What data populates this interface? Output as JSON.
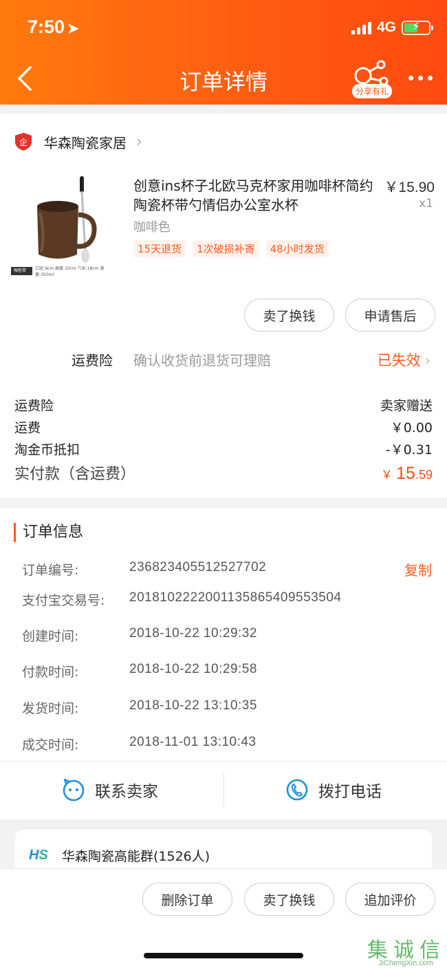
{
  "status_bar": {
    "time": "7:50",
    "network": "4G"
  },
  "nav": {
    "title": "订单详情",
    "share_badge": "分享有礼"
  },
  "shop": {
    "name": "华森陶瓷家居"
  },
  "product": {
    "title": "创意ins杯子北欧马克杯家用咖啡杯简约陶瓷杯带勺情侣办公室水杯",
    "price": "￥15.90",
    "qty": "x1",
    "sku": "咖啡色",
    "tags": [
      "15天退货",
      "1次破损补寄",
      "48小时发货"
    ],
    "image_tag": "咖色带勺",
    "image_caption": "口径:9cm 高度:10cm 勺长:18cm 容量:350ml"
  },
  "actions_top": {
    "sell_for_cash": "卖了换钱",
    "after_sales": "申请售后"
  },
  "insurance": {
    "label": "运费险",
    "desc": "确认收货前退货可理赔",
    "status": "已失效"
  },
  "fees": {
    "insurance_label": "运费险",
    "insurance_value": "卖家赠送",
    "shipping_label": "运费",
    "shipping_value": "￥0.00",
    "coin_label": "淘金币抵扣",
    "coin_value": "-￥0.31",
    "total_label": "实付款（含运费）",
    "total_symbol": "￥",
    "total_int": "15",
    "total_dec": ".59"
  },
  "order_info": {
    "title": "订单信息",
    "copy": "复制",
    "rows": [
      {
        "key": "订单编号:",
        "value": "236823405512527702"
      },
      {
        "key": "支付宝交易号:",
        "value": "2018102222001135865409553504"
      },
      {
        "key": "创建时间:",
        "value": "2018-10-22 10:29:32"
      },
      {
        "key": "付款时间:",
        "value": "2018-10-22 10:29:58"
      },
      {
        "key": "发货时间:",
        "value": "2018-10-22 13:10:35"
      },
      {
        "key": "成交时间:",
        "value": "2018-11-01 13:10:43"
      }
    ]
  },
  "contact": {
    "seller": "联系卖家",
    "call": "拨打电话"
  },
  "group": {
    "logo": "HS",
    "name": "华森陶瓷高能群(1526人)"
  },
  "bottom_actions": {
    "delete": "删除订单",
    "sell": "卖了换钱",
    "review": "追加评价"
  },
  "watermark": {
    "chars": [
      "集",
      "诚",
      "信"
    ],
    "url": "JiChengXin.com"
  },
  "colors": {
    "brand": "#ff5a12",
    "accent": "#ff5a1f",
    "link_blue": "#1e8fd6"
  }
}
